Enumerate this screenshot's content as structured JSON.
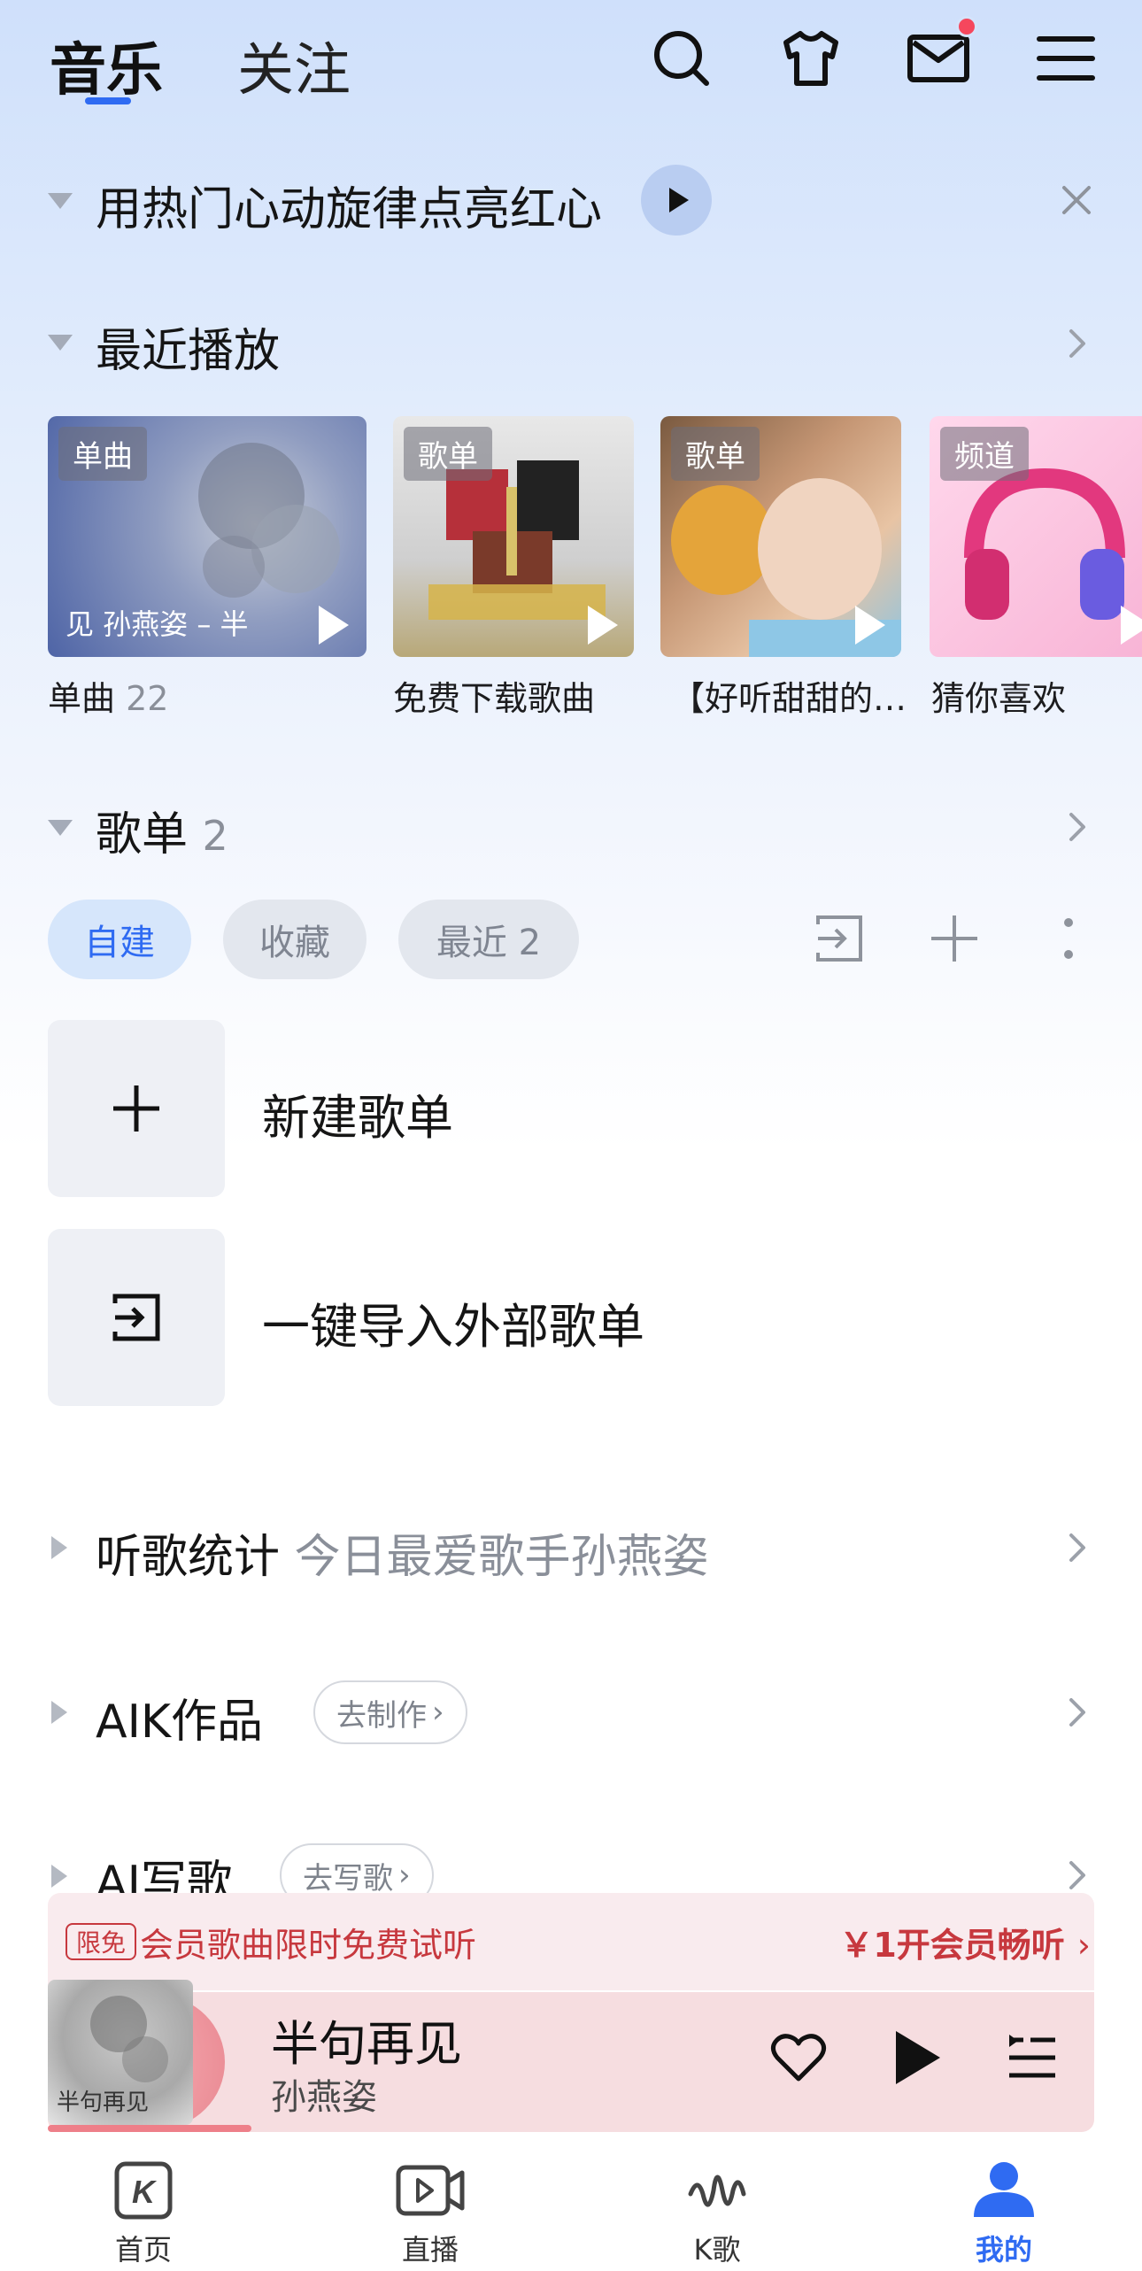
{
  "header": {
    "tabs": [
      {
        "label": "音乐",
        "active": true
      },
      {
        "label": "关注",
        "active": false
      }
    ],
    "icons": [
      "search-icon",
      "skin-shirt-icon",
      "mail-icon",
      "menu-icon"
    ],
    "mail_has_notification": true
  },
  "banner": {
    "text": "用热门心动旋律点亮红心"
  },
  "recent": {
    "title": "最近播放",
    "cards": [
      {
        "badge": "单曲",
        "inner_text": "见    孙燕姿 – 半",
        "caption_main": "单曲",
        "caption_count": "22"
      },
      {
        "badge": "歌单",
        "caption_main": "免费下载歌曲"
      },
      {
        "badge": "歌单",
        "caption_main": "【好听甜甜的…"
      },
      {
        "badge": "频道",
        "caption_main": "猜你喜欢"
      }
    ]
  },
  "playlists": {
    "title": "歌单",
    "count": "2",
    "chips": [
      {
        "label": "自建",
        "active": true
      },
      {
        "label": "收藏",
        "active": false
      },
      {
        "label": "最近 2",
        "active": false
      }
    ],
    "rows": [
      {
        "label": "新建歌单",
        "icon": "plus-icon"
      },
      {
        "label": "一键导入外部歌单",
        "icon": "import-icon"
      }
    ]
  },
  "stats": {
    "title": "听歌统计",
    "subtitle": "今日最爱歌手孙燕姿"
  },
  "aik": {
    "title": "AIK作品",
    "button": "去制作"
  },
  "ai_song": {
    "title": "AI写歌",
    "button": "去写歌"
  },
  "vip": {
    "tag": "限免",
    "text": "会员歌曲限时免费试听",
    "action": "￥1开会员畅听"
  },
  "player": {
    "title": "半句再见",
    "artist": "孙燕姿",
    "cover_text": "半句再见",
    "progress": 0.12
  },
  "bottom_nav": [
    {
      "label": "首页",
      "icon": "home-k-icon",
      "active": false
    },
    {
      "label": "直播",
      "icon": "live-video-icon",
      "active": false
    },
    {
      "label": "K歌",
      "icon": "karaoke-wave-icon",
      "active": false
    },
    {
      "label": "我的",
      "icon": "profile-icon",
      "active": true
    }
  ],
  "colors": {
    "accent": "#2f6bf2",
    "vip_red": "#c7383e",
    "notification": "#f5475d"
  }
}
